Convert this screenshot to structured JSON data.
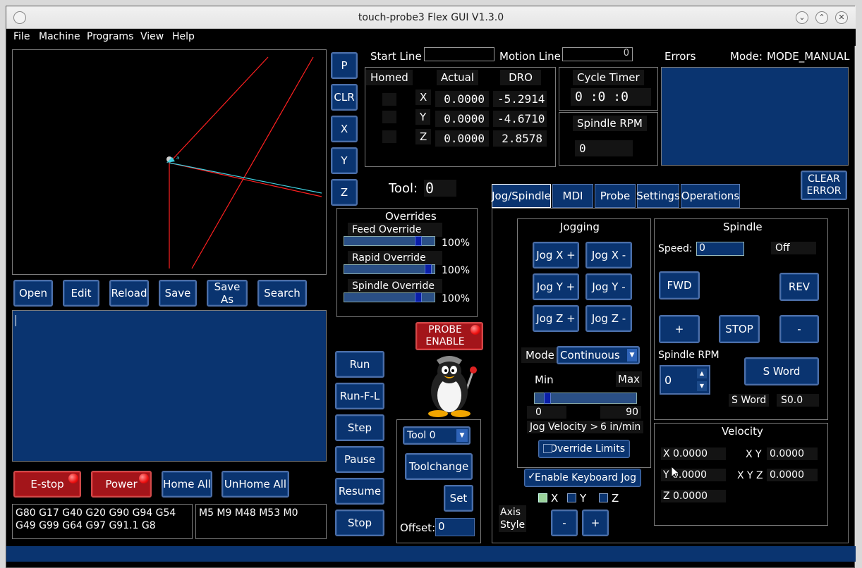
{
  "window": {
    "title": "touch-probe3 Flex GUI V1.3.0"
  },
  "menu": [
    "File",
    "Machine",
    "Programs",
    "View",
    "Help"
  ],
  "preview_buttons": [
    "P",
    "CLR",
    "X",
    "Y",
    "Z"
  ],
  "file_buttons": [
    "Open",
    "Edit",
    "Reload",
    "Save",
    "Save As",
    "Search"
  ],
  "start_line": {
    "label": "Start Line",
    "value": ""
  },
  "motion_line": {
    "label": "Motion Line",
    "value": "0"
  },
  "dro": {
    "headers": {
      "homed": "Homed",
      "actual": "Actual",
      "dro": "DRO"
    },
    "rows": [
      {
        "axis": "X",
        "actual": "0.0000",
        "dro": "-5.2914"
      },
      {
        "axis": "Y",
        "actual": "0.0000",
        "dro": "-4.6710"
      },
      {
        "axis": "Z",
        "actual": "0.0000",
        "dro": "2.8578"
      }
    ]
  },
  "cycle_timer": {
    "label": "Cycle Timer",
    "h": "0",
    "m": "0",
    "s": "0",
    "sep": ":"
  },
  "spindle_rpm_top": {
    "label": "Spindle RPM",
    "value": "0"
  },
  "errors": {
    "label": "Errors",
    "clear_label": "CLEAR ERROR"
  },
  "mode": {
    "label": "Mode:",
    "value": "MODE_MANUAL"
  },
  "tool": {
    "label": "Tool:",
    "value": "0"
  },
  "overrides": {
    "title": "Overrides",
    "feed": {
      "label": "Feed Override",
      "value": "100%",
      "level": 0.85
    },
    "rapid": {
      "label": "Rapid Override",
      "value": "100%",
      "level": 0.97
    },
    "spindle": {
      "label": "Spindle Override",
      "value": "100%",
      "level": 0.85
    }
  },
  "probe_enable": "PROBE ENABLE",
  "run_buttons": [
    "Run",
    "Run-F-L",
    "Step",
    "Pause",
    "Resume",
    "Stop"
  ],
  "bottom_buttons": {
    "estop": "E-stop",
    "power": "Power",
    "home_all": "Home All",
    "unhome_all": "UnHome All"
  },
  "gcodes": "G80 G17 G40 G20 G90 G94 G54 G49 G99 G64 G97 G91.1 G8",
  "mcodes": "M5 M9 M48 M53 M0",
  "toolchange": {
    "tool_select": "Tool 0",
    "toolchange_label": "Toolchange",
    "set_label": "Set",
    "offset_label": "Offset:",
    "offset_value": "0"
  },
  "tabs": [
    "Jog/Spindle",
    "MDI",
    "Probe",
    "Settings",
    "Operations"
  ],
  "jogging": {
    "title": "Jogging",
    "buttons": [
      "Jog X +",
      "Jog X -",
      "Jog Y +",
      "Jog Y -",
      "Jog Z +",
      "Jog Z -"
    ],
    "mode_label": "Mode",
    "mode_value": "Continuous",
    "min_label": "Min",
    "max_label": "Max",
    "min_value": "0",
    "max_value": "90",
    "slider_level": 0.1,
    "velocity_label": "Jog Velocity >",
    "velocity_value": "6 in/min",
    "override_limits": "Override Limits"
  },
  "keyboard_jog": {
    "label": "Enable Keyboard Jog",
    "checkmark": "✓"
  },
  "axis_style": {
    "label_line1": "Axis",
    "label_line2": "Style",
    "x": "X",
    "y": "Y",
    "z": "Z",
    "minus": "-",
    "plus": "+"
  },
  "spindle": {
    "title": "Spindle",
    "speed_label": "Speed:",
    "speed_value": "0",
    "state": "Off",
    "fwd": "FWD",
    "rev": "REV",
    "plus": "+",
    "stop": "STOP",
    "minus": "-",
    "rpm_label": "Spindle RPM",
    "rpm_value": "0",
    "s_word_button": "S Word",
    "s_word_label": "S Word",
    "s_word_value": "S0.0"
  },
  "velocity": {
    "title": "Velocity",
    "rows": [
      {
        "label": "X",
        "value": "0.0000",
        "label2": "X Y",
        "value2": "0.0000"
      },
      {
        "label": "Y",
        "value": "0.0000",
        "label2": "X Y Z",
        "value2": "0.0000"
      },
      {
        "label": "Z",
        "value": "0.0000"
      }
    ]
  },
  "colors": {
    "panel_blue": "#0a3470",
    "red_button": "#a3151a",
    "background": "#000000"
  }
}
